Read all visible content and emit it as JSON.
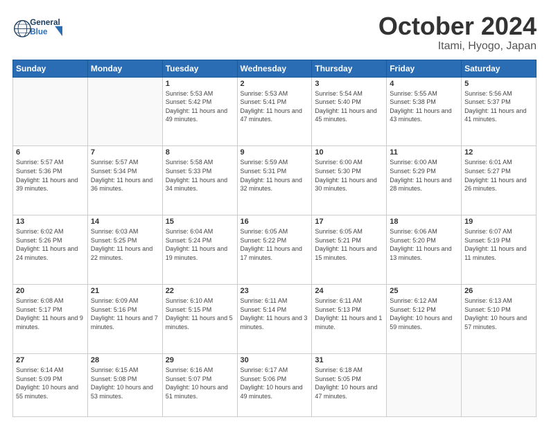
{
  "header": {
    "logo_general": "General",
    "logo_blue": "Blue",
    "month": "October 2024",
    "location": "Itami, Hyogo, Japan"
  },
  "weekdays": [
    "Sunday",
    "Monday",
    "Tuesday",
    "Wednesday",
    "Thursday",
    "Friday",
    "Saturday"
  ],
  "weeks": [
    [
      {
        "day": "",
        "sunrise": "",
        "sunset": "",
        "daylight": ""
      },
      {
        "day": "",
        "sunrise": "",
        "sunset": "",
        "daylight": ""
      },
      {
        "day": "1",
        "sunrise": "Sunrise: 5:53 AM",
        "sunset": "Sunset: 5:42 PM",
        "daylight": "Daylight: 11 hours and 49 minutes."
      },
      {
        "day": "2",
        "sunrise": "Sunrise: 5:53 AM",
        "sunset": "Sunset: 5:41 PM",
        "daylight": "Daylight: 11 hours and 47 minutes."
      },
      {
        "day": "3",
        "sunrise": "Sunrise: 5:54 AM",
        "sunset": "Sunset: 5:40 PM",
        "daylight": "Daylight: 11 hours and 45 minutes."
      },
      {
        "day": "4",
        "sunrise": "Sunrise: 5:55 AM",
        "sunset": "Sunset: 5:38 PM",
        "daylight": "Daylight: 11 hours and 43 minutes."
      },
      {
        "day": "5",
        "sunrise": "Sunrise: 5:56 AM",
        "sunset": "Sunset: 5:37 PM",
        "daylight": "Daylight: 11 hours and 41 minutes."
      }
    ],
    [
      {
        "day": "6",
        "sunrise": "Sunrise: 5:57 AM",
        "sunset": "Sunset: 5:36 PM",
        "daylight": "Daylight: 11 hours and 39 minutes."
      },
      {
        "day": "7",
        "sunrise": "Sunrise: 5:57 AM",
        "sunset": "Sunset: 5:34 PM",
        "daylight": "Daylight: 11 hours and 36 minutes."
      },
      {
        "day": "8",
        "sunrise": "Sunrise: 5:58 AM",
        "sunset": "Sunset: 5:33 PM",
        "daylight": "Daylight: 11 hours and 34 minutes."
      },
      {
        "day": "9",
        "sunrise": "Sunrise: 5:59 AM",
        "sunset": "Sunset: 5:31 PM",
        "daylight": "Daylight: 11 hours and 32 minutes."
      },
      {
        "day": "10",
        "sunrise": "Sunrise: 6:00 AM",
        "sunset": "Sunset: 5:30 PM",
        "daylight": "Daylight: 11 hours and 30 minutes."
      },
      {
        "day": "11",
        "sunrise": "Sunrise: 6:00 AM",
        "sunset": "Sunset: 5:29 PM",
        "daylight": "Daylight: 11 hours and 28 minutes."
      },
      {
        "day": "12",
        "sunrise": "Sunrise: 6:01 AM",
        "sunset": "Sunset: 5:27 PM",
        "daylight": "Daylight: 11 hours and 26 minutes."
      }
    ],
    [
      {
        "day": "13",
        "sunrise": "Sunrise: 6:02 AM",
        "sunset": "Sunset: 5:26 PM",
        "daylight": "Daylight: 11 hours and 24 minutes."
      },
      {
        "day": "14",
        "sunrise": "Sunrise: 6:03 AM",
        "sunset": "Sunset: 5:25 PM",
        "daylight": "Daylight: 11 hours and 22 minutes."
      },
      {
        "day": "15",
        "sunrise": "Sunrise: 6:04 AM",
        "sunset": "Sunset: 5:24 PM",
        "daylight": "Daylight: 11 hours and 19 minutes."
      },
      {
        "day": "16",
        "sunrise": "Sunrise: 6:05 AM",
        "sunset": "Sunset: 5:22 PM",
        "daylight": "Daylight: 11 hours and 17 minutes."
      },
      {
        "day": "17",
        "sunrise": "Sunrise: 6:05 AM",
        "sunset": "Sunset: 5:21 PM",
        "daylight": "Daylight: 11 hours and 15 minutes."
      },
      {
        "day": "18",
        "sunrise": "Sunrise: 6:06 AM",
        "sunset": "Sunset: 5:20 PM",
        "daylight": "Daylight: 11 hours and 13 minutes."
      },
      {
        "day": "19",
        "sunrise": "Sunrise: 6:07 AM",
        "sunset": "Sunset: 5:19 PM",
        "daylight": "Daylight: 11 hours and 11 minutes."
      }
    ],
    [
      {
        "day": "20",
        "sunrise": "Sunrise: 6:08 AM",
        "sunset": "Sunset: 5:17 PM",
        "daylight": "Daylight: 11 hours and 9 minutes."
      },
      {
        "day": "21",
        "sunrise": "Sunrise: 6:09 AM",
        "sunset": "Sunset: 5:16 PM",
        "daylight": "Daylight: 11 hours and 7 minutes."
      },
      {
        "day": "22",
        "sunrise": "Sunrise: 6:10 AM",
        "sunset": "Sunset: 5:15 PM",
        "daylight": "Daylight: 11 hours and 5 minutes."
      },
      {
        "day": "23",
        "sunrise": "Sunrise: 6:11 AM",
        "sunset": "Sunset: 5:14 PM",
        "daylight": "Daylight: 11 hours and 3 minutes."
      },
      {
        "day": "24",
        "sunrise": "Sunrise: 6:11 AM",
        "sunset": "Sunset: 5:13 PM",
        "daylight": "Daylight: 11 hours and 1 minute."
      },
      {
        "day": "25",
        "sunrise": "Sunrise: 6:12 AM",
        "sunset": "Sunset: 5:12 PM",
        "daylight": "Daylight: 10 hours and 59 minutes."
      },
      {
        "day": "26",
        "sunrise": "Sunrise: 6:13 AM",
        "sunset": "Sunset: 5:10 PM",
        "daylight": "Daylight: 10 hours and 57 minutes."
      }
    ],
    [
      {
        "day": "27",
        "sunrise": "Sunrise: 6:14 AM",
        "sunset": "Sunset: 5:09 PM",
        "daylight": "Daylight: 10 hours and 55 minutes."
      },
      {
        "day": "28",
        "sunrise": "Sunrise: 6:15 AM",
        "sunset": "Sunset: 5:08 PM",
        "daylight": "Daylight: 10 hours and 53 minutes."
      },
      {
        "day": "29",
        "sunrise": "Sunrise: 6:16 AM",
        "sunset": "Sunset: 5:07 PM",
        "daylight": "Daylight: 10 hours and 51 minutes."
      },
      {
        "day": "30",
        "sunrise": "Sunrise: 6:17 AM",
        "sunset": "Sunset: 5:06 PM",
        "daylight": "Daylight: 10 hours and 49 minutes."
      },
      {
        "day": "31",
        "sunrise": "Sunrise: 6:18 AM",
        "sunset": "Sunset: 5:05 PM",
        "daylight": "Daylight: 10 hours and 47 minutes."
      },
      {
        "day": "",
        "sunrise": "",
        "sunset": "",
        "daylight": ""
      },
      {
        "day": "",
        "sunrise": "",
        "sunset": "",
        "daylight": ""
      }
    ]
  ]
}
